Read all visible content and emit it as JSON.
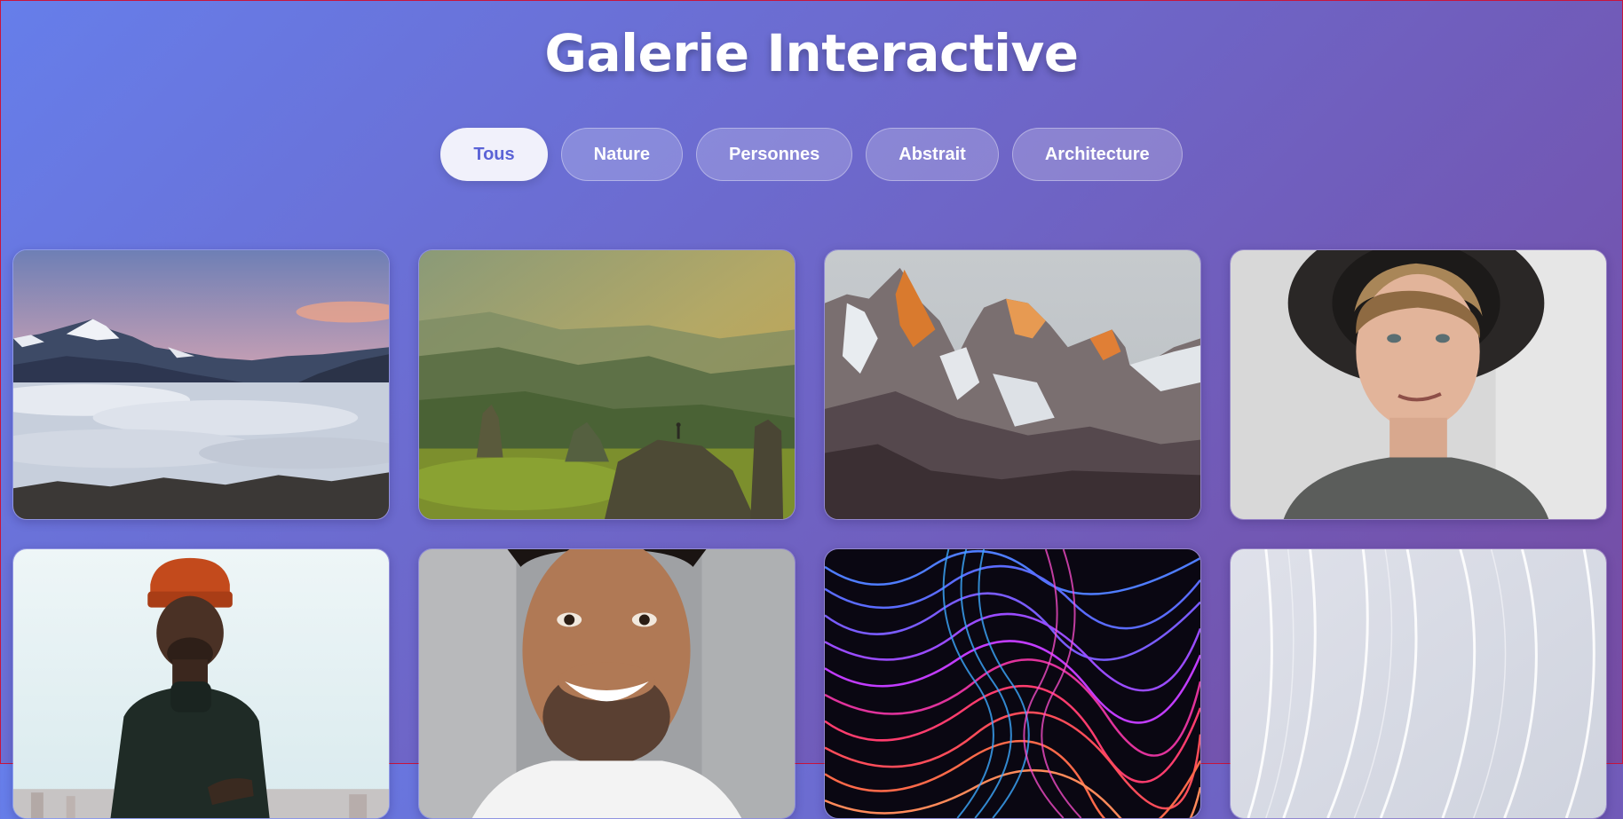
{
  "page": {
    "title": "Galerie Interactive"
  },
  "filters": [
    {
      "label": "Tous",
      "active": true
    },
    {
      "label": "Nature",
      "active": false
    },
    {
      "label": "Personnes",
      "active": false
    },
    {
      "label": "Abstrait",
      "active": false
    },
    {
      "label": "Architecture",
      "active": false
    }
  ],
  "gallery": [
    {
      "category": "Nature",
      "subject": "mountains-above-clouds"
    },
    {
      "category": "Nature",
      "subject": "green-valley-hiker"
    },
    {
      "category": "Nature",
      "subject": "snowy-peaks"
    },
    {
      "category": "Personnes",
      "subject": "man-black-hat"
    },
    {
      "category": "Personnes",
      "subject": "man-orange-beanie"
    },
    {
      "category": "Personnes",
      "subject": "smiling-man"
    },
    {
      "category": "Abstrait",
      "subject": "neon-waves"
    },
    {
      "category": "Abstrait",
      "subject": "white-waves"
    }
  ],
  "colors": {
    "background_start": "#667eea",
    "background_end": "#764ba2",
    "active_text": "#5b63d6"
  }
}
